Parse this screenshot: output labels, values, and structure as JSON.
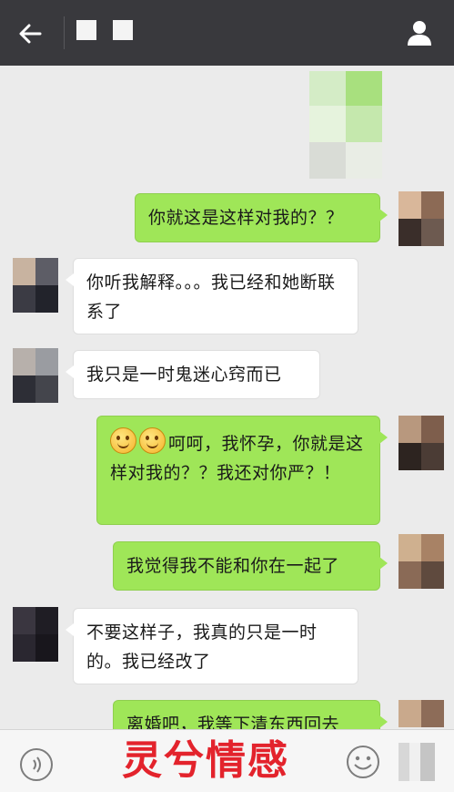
{
  "header": {
    "back_icon": "back-arrow-icon",
    "contact_icon": "person-icon"
  },
  "messages": [
    {
      "side": "me",
      "text": "你就这是这样对我的？？"
    },
    {
      "side": "other",
      "text": "你听我解释。。。我已经和她断联系了"
    },
    {
      "side": "other",
      "text": "我只是一时鬼迷心窍而已"
    },
    {
      "side": "me",
      "emoji": "smile-emoji",
      "text": "呵呵，我怀孕，你就是这样对我的？？我还对你严？！"
    },
    {
      "side": "me",
      "text": "我觉得我不能和你在一起了"
    },
    {
      "side": "other",
      "text": "不要这样子，我真的只是一时的。我已经改了"
    },
    {
      "side": "me",
      "text": "离婚吧，我等下清东西回去"
    }
  ],
  "bottom": {
    "watermark": "灵兮情感",
    "voice_icon": "voice-icon",
    "emoji_icon": "emoji-face-icon"
  },
  "colors": {
    "topbar": "#39393d",
    "my_bubble": "#9fe658",
    "their_bubble": "#ffffff",
    "watermark": "#e3232c",
    "background": "#ebebeb"
  }
}
